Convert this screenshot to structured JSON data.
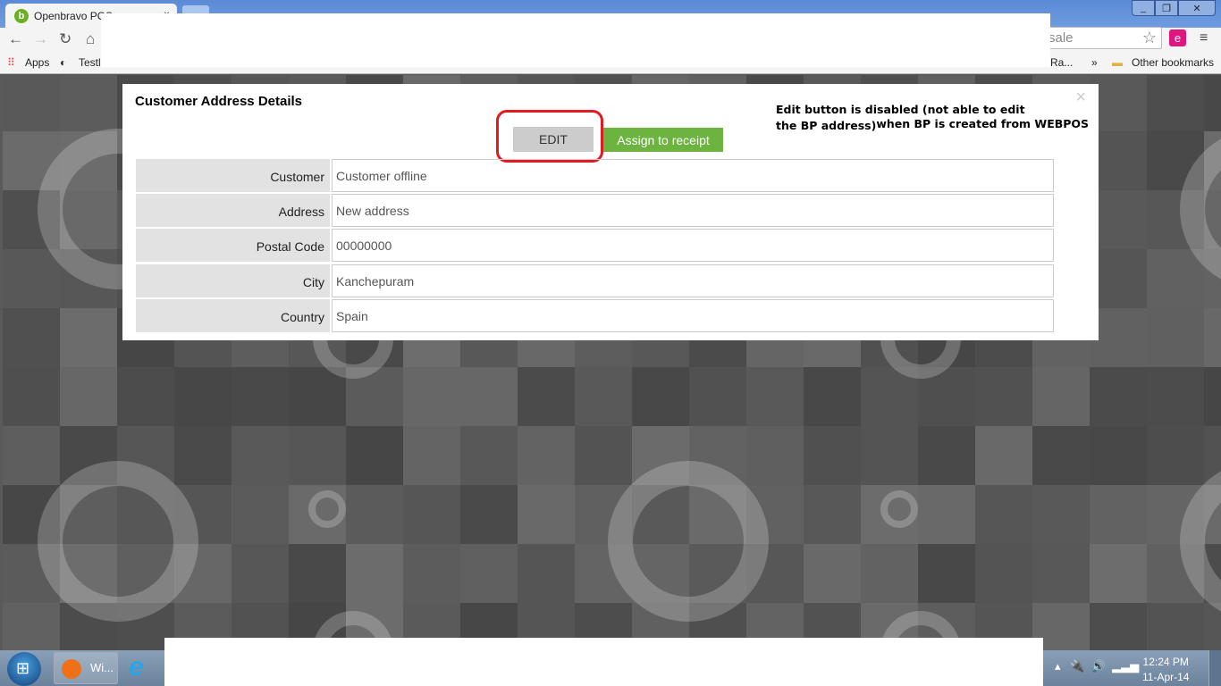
{
  "browser": {
    "tab_title": "Openbravo POS",
    "tab_close": "×",
    "omnibox_text": "sale",
    "bookmarks": {
      "apps": "Apps",
      "testlink": "Testl",
      "partial": "Ra...",
      "overflow": "»",
      "other": "Other bookmarks"
    }
  },
  "dialog": {
    "title": "Customer Address Details",
    "close": "×",
    "edit_label": "EDIT",
    "assign_label": "Assign to receipt",
    "annotation_line1": "Edit button is disabled (not able to edit",
    "annotation_line2a": "the BP address)",
    "annotation_line2b": "when BP is created from WEBPOS",
    "rows": [
      {
        "label": "Customer",
        "value": "Customer offline"
      },
      {
        "label": "Address",
        "value": "New address"
      },
      {
        "label": "Postal Code",
        "value": "00000000"
      },
      {
        "label": "City",
        "value": "Kanchepuram"
      },
      {
        "label": "Country",
        "value": "Spain"
      }
    ]
  },
  "taskbar": {
    "wmp_label": "Wi...",
    "time": "12:24 PM",
    "date": "11-Apr-14"
  },
  "colors": {
    "accent_green": "#6cb33f",
    "highlight_red": "#e01b22",
    "edit_disabled": "#cccccc"
  }
}
